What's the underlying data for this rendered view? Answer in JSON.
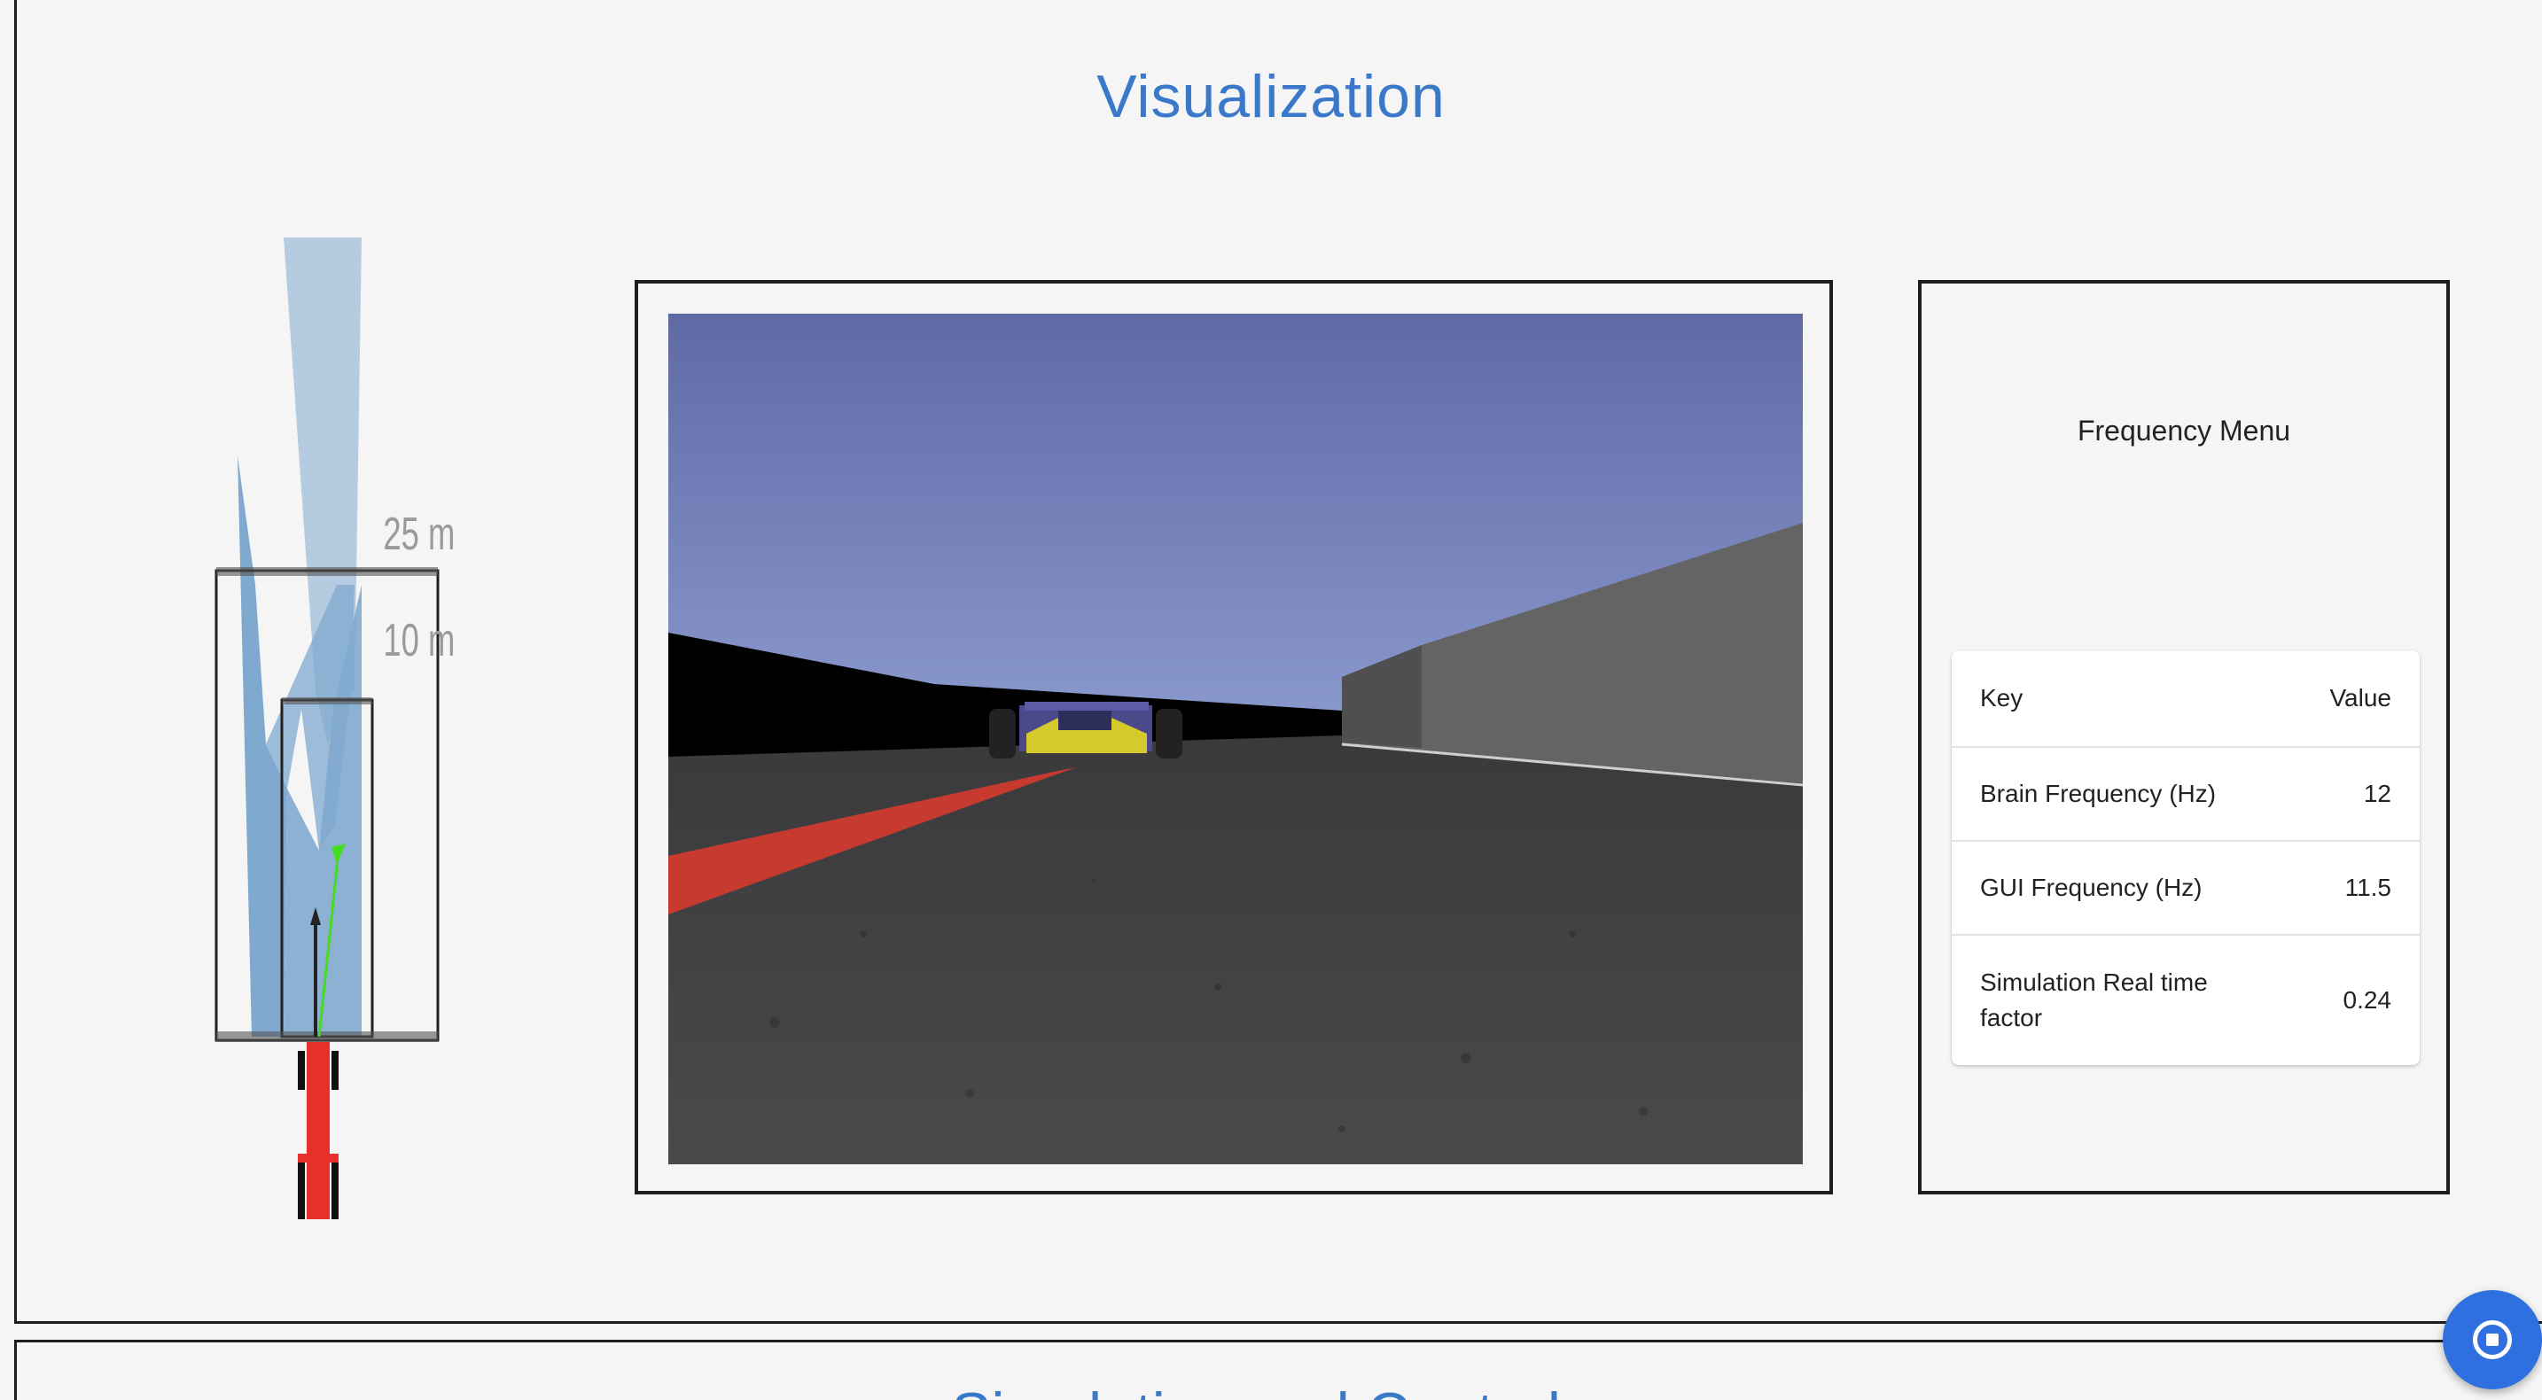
{
  "sections": {
    "visualization_title": "Visualization",
    "next_section_title": "Simulation and Controls"
  },
  "lidar": {
    "range_far_label": "25 m",
    "range_near_label": "10 m"
  },
  "frequency_menu": {
    "title": "Frequency Menu",
    "header": {
      "key": "Key",
      "value": "Value"
    },
    "rows": [
      {
        "key": "Brain Frequency (Hz)",
        "value": "12"
      },
      {
        "key": "GUI Frequency (Hz)",
        "value": "11.5"
      },
      {
        "key": "Simulation Real time factor",
        "value": "0.24"
      }
    ]
  },
  "fab": {
    "icon": "stop-circle-icon",
    "color": "#2f6fe0"
  },
  "colors": {
    "accent_title": "#3a79c9",
    "border": "#1e1e1e",
    "background": "#f5f5f5"
  }
}
